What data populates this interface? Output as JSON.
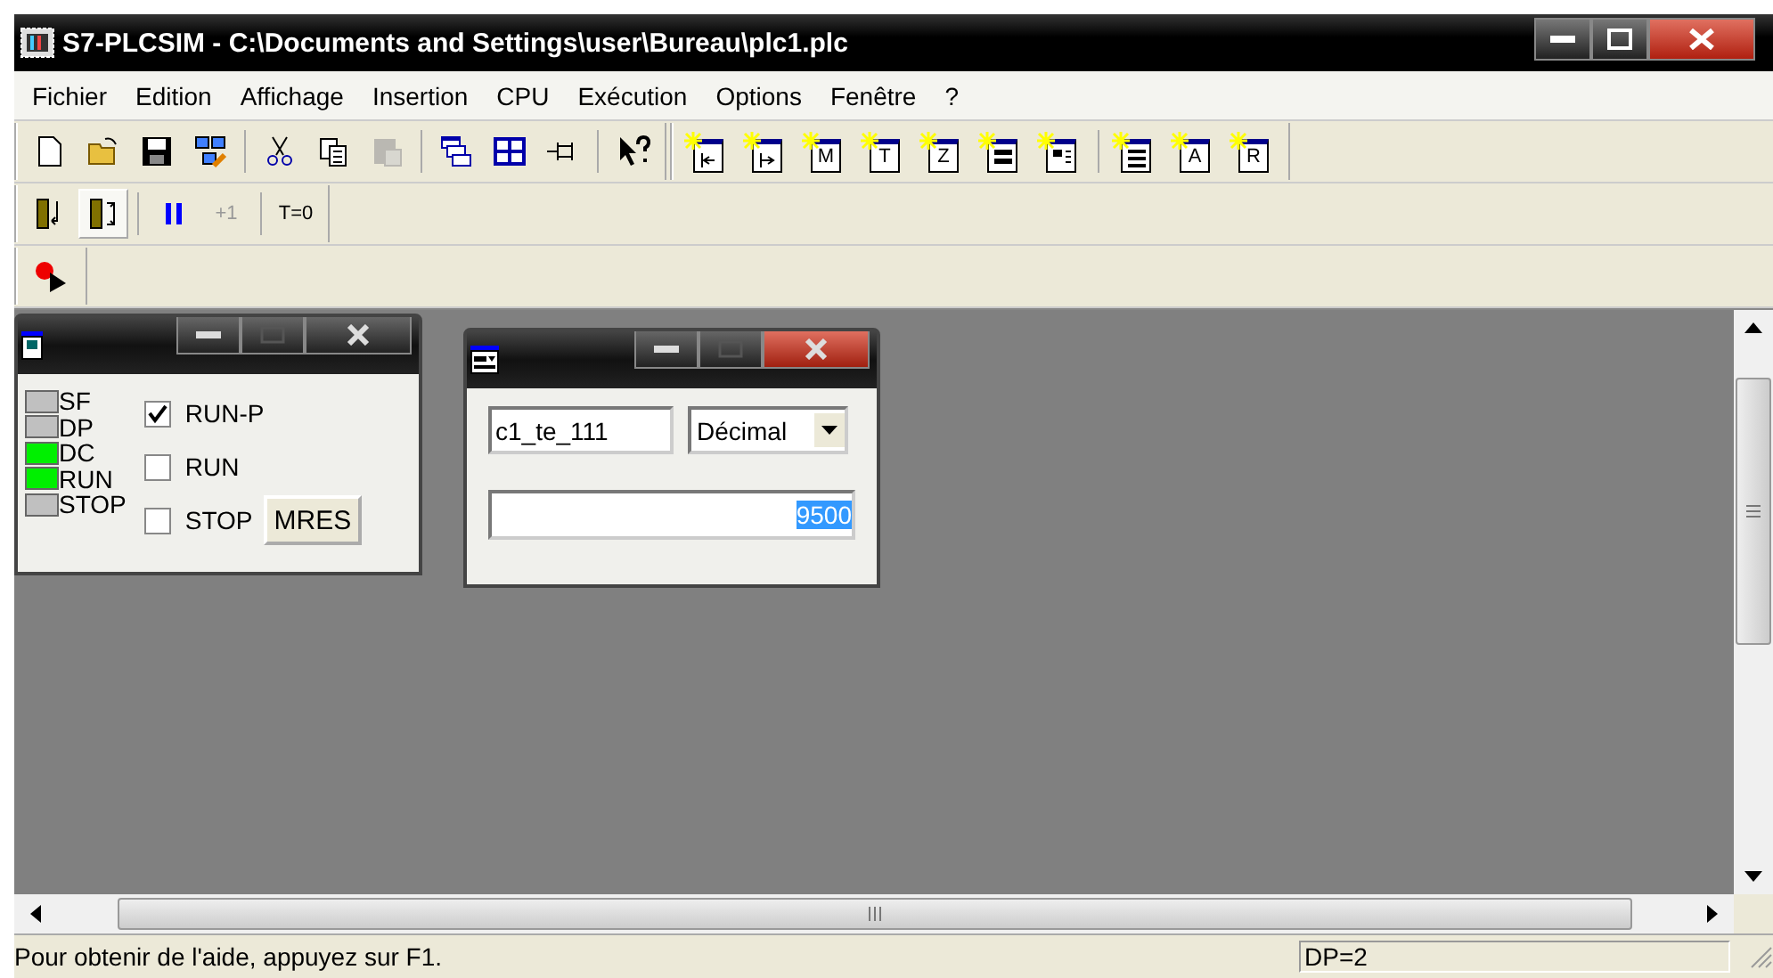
{
  "window": {
    "title": "S7-PLCSIM - C:\\Documents and Settings\\user\\Bureau\\plc1.plc"
  },
  "menu": [
    "Fichier",
    "Edition",
    "Affichage",
    "Insertion",
    "CPU",
    "Exécution",
    "Options",
    "Fenêtre",
    "?"
  ],
  "toolbar_main": [
    {
      "kind": "new"
    },
    {
      "kind": "open"
    },
    {
      "kind": "save"
    },
    {
      "kind": "network"
    },
    {
      "kind": "sep"
    },
    {
      "kind": "cut"
    },
    {
      "kind": "copy"
    },
    {
      "kind": "paste",
      "disabled": true
    },
    {
      "kind": "sep"
    },
    {
      "kind": "cascade"
    },
    {
      "kind": "tile"
    },
    {
      "kind": "pin"
    },
    {
      "kind": "sep"
    },
    {
      "kind": "help"
    }
  ],
  "toolbar_insert": [
    {
      "kind": "in"
    },
    {
      "kind": "out"
    },
    {
      "kind": "letter",
      "letter": "M"
    },
    {
      "kind": "letter",
      "letter": "T"
    },
    {
      "kind": "letter",
      "letter": "Z"
    },
    {
      "kind": "var"
    },
    {
      "kind": "stack"
    },
    {
      "kind": "sep"
    },
    {
      "kind": "list"
    },
    {
      "kind": "letter",
      "letter": "A"
    },
    {
      "kind": "letter",
      "letter": "R"
    }
  ],
  "toolbar_run": [
    {
      "kind": "single",
      "selected": false
    },
    {
      "kind": "cycle",
      "selected": true
    },
    {
      "kind": "sep"
    },
    {
      "kind": "pause"
    },
    {
      "kind": "text",
      "label": "+1",
      "disabled": true
    },
    {
      "kind": "sep"
    },
    {
      "kind": "text",
      "label": "T=0",
      "disabled": false
    }
  ],
  "cpu_window": {
    "leds": [
      {
        "label": "SF",
        "on": false
      },
      {
        "label": "DP",
        "on": false
      },
      {
        "label": "DC",
        "on": true
      },
      {
        "label": "RUN",
        "on": true
      },
      {
        "label": "STOP",
        "on": false
      }
    ],
    "modes": [
      {
        "label": "RUN-P",
        "checked": true
      },
      {
        "label": "RUN",
        "checked": false
      },
      {
        "label": "STOP",
        "checked": false
      }
    ],
    "button": "MRES"
  },
  "var_window": {
    "address": "c1_te_111",
    "format": "Décimal",
    "value": "9500"
  },
  "status_bar": {
    "message": "Pour obtenir de l'aide, appuyez sur F1.",
    "panel": "DP=2"
  }
}
